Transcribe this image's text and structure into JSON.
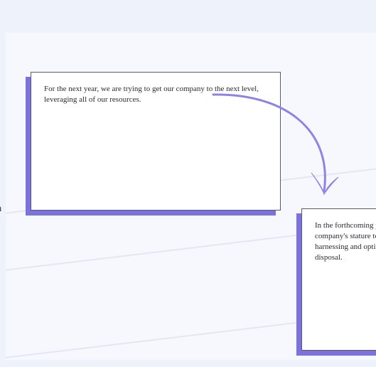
{
  "canvas": {
    "card1": {
      "text": "For the next year, we are trying to get our company to the next level, leveraging all of our resources."
    },
    "card2": {
      "text": "In the forthcoming year, we aspire to elevate our company's stature to unprecedented heights, adeptly harnessing and optimizing all available resources at our disposal."
    }
  },
  "left_edge_glyph": "a",
  "colors": {
    "page_bg": "#eef2fb",
    "canvas_bg": "#f6f8fe",
    "card_shadow": "#7b72e0",
    "card_border": "#5a5a6a",
    "arrow": "#8e82e6",
    "guide_line": "#e3e7f4"
  },
  "arrow": {
    "name": "curved-arrow"
  }
}
